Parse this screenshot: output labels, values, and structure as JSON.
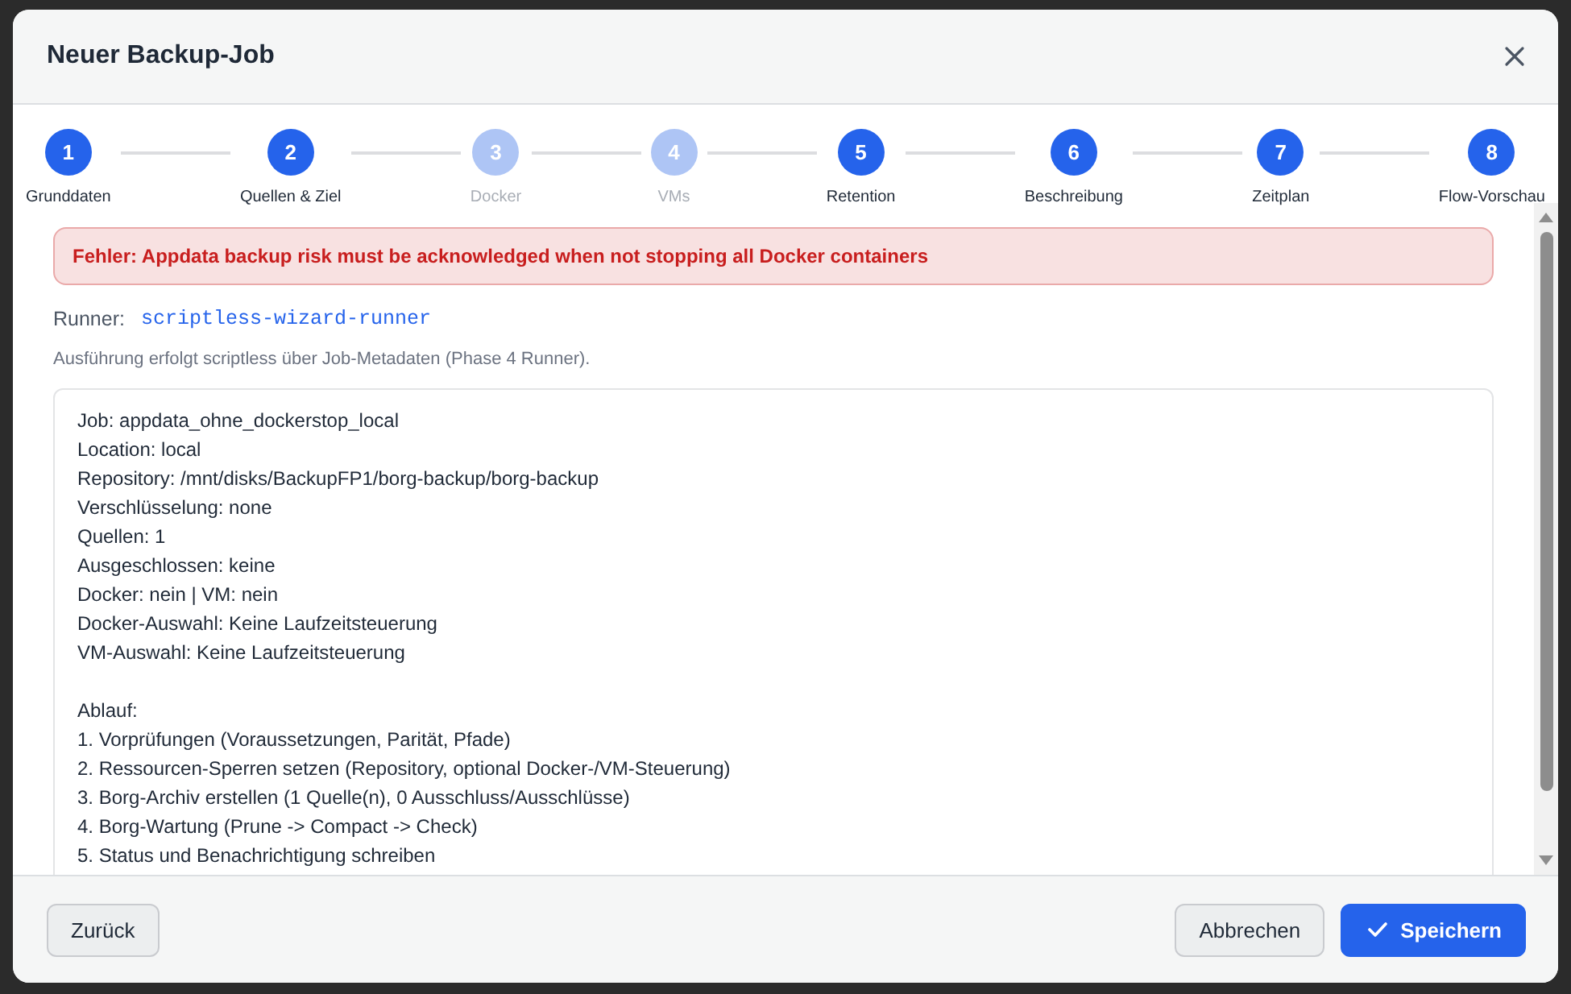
{
  "dialog": {
    "title": "Neuer Backup-Job"
  },
  "steps": [
    {
      "number": "1",
      "label": "Grunddaten",
      "disabled": false
    },
    {
      "number": "2",
      "label": "Quellen & Ziel",
      "disabled": false
    },
    {
      "number": "3",
      "label": "Docker",
      "disabled": true
    },
    {
      "number": "4",
      "label": "VMs",
      "disabled": true
    },
    {
      "number": "5",
      "label": "Retention",
      "disabled": false
    },
    {
      "number": "6",
      "label": "Beschreibung",
      "disabled": false
    },
    {
      "number": "7",
      "label": "Zeitplan",
      "disabled": false
    },
    {
      "number": "8",
      "label": "Flow-Vorschau",
      "disabled": false
    }
  ],
  "error": "Fehler: Appdata backup risk must be acknowledged when not stopping all Docker containers",
  "runner": {
    "label": "Runner:",
    "value": "scriptless-wizard-runner"
  },
  "info": "Ausführung erfolgt scriptless über Job-Metadaten (Phase 4 Runner).",
  "summary": {
    "details": [
      "Job: appdata_ohne_dockerstop_local",
      "Location: local",
      "Repository: /mnt/disks/BackupFP1/borg-backup/borg-backup",
      "Verschlüsselung: none",
      "Quellen: 1",
      "Ausgeschlossen: keine",
      "Docker: nein | VM: nein",
      "Docker-Auswahl: Keine Laufzeitsteuerung",
      "VM-Auswahl: Keine Laufzeitsteuerung"
    ],
    "flow_title": "Ablauf:",
    "flow_steps": [
      "1. Vorprüfungen (Voraussetzungen, Parität, Pfade)",
      "2. Ressourcen-Sperren setzen (Repository, optional Docker-/VM-Steuerung)",
      "3. Borg-Archiv erstellen (1 Quelle(n), 0 Ausschluss/Ausschlüsse)",
      "4. Borg-Wartung (Prune -> Compact -> Check)",
      "5. Status und Benachrichtigung schreiben"
    ]
  },
  "footer": {
    "back": "Zurück",
    "cancel": "Abbrechen",
    "save": "Speichern"
  }
}
